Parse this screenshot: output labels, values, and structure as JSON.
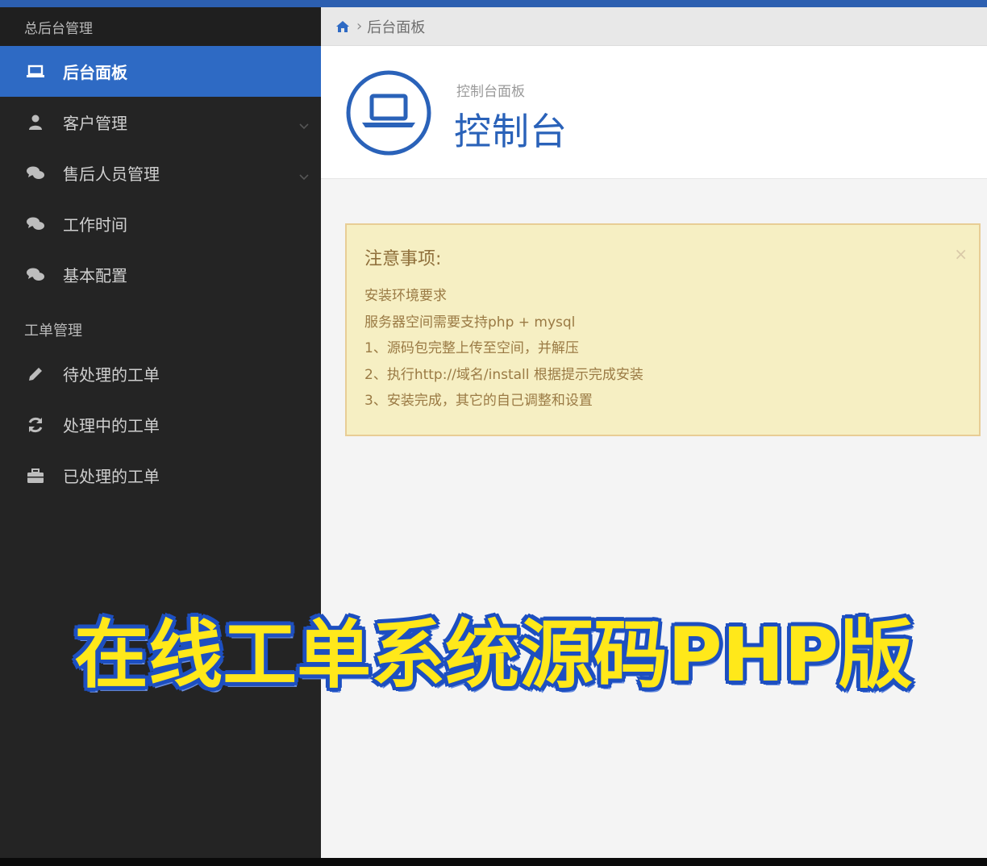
{
  "colors": {
    "accent": "#2e6ac4",
    "sidebar_bg": "#242424",
    "caption_text": "#ffe81a",
    "caption_outline": "#1d4fc0",
    "notice_bg": "#f6efc3"
  },
  "sidebar": {
    "header": "总后台管理",
    "items": [
      {
        "label": "后台面板",
        "icon": "laptop-icon",
        "active": true
      },
      {
        "label": "客户管理",
        "icon": "user-icon",
        "has_submenu": true
      },
      {
        "label": "售后人员管理",
        "icon": "comments-icon",
        "has_submenu": true
      },
      {
        "label": "工作时间",
        "icon": "comments-icon"
      },
      {
        "label": "基本配置",
        "icon": "comments-icon"
      }
    ],
    "section_label": "工单管理",
    "section_items": [
      {
        "label": "待处理的工单",
        "icon": "pencil-icon"
      },
      {
        "label": "处理中的工单",
        "icon": "refresh-icon"
      },
      {
        "label": "已处理的工单",
        "icon": "briefcase-icon"
      }
    ]
  },
  "breadcrumb": {
    "icon": "home-icon",
    "current": "后台面板"
  },
  "header": {
    "icon": "laptop-icon",
    "subtitle": "控制台面板",
    "title": "控制台"
  },
  "notice": {
    "title": "注意事项:",
    "close": "×",
    "lines": [
      "安装环境要求",
      "服务器空间需要支持php + mysql",
      "1、源码包完整上传至空间，并解压",
      "2、执行http://域名/install 根据提示完成安装",
      "3、安装完成，其它的自己调整和设置"
    ]
  },
  "caption": "在线工单系统源码PHP版"
}
